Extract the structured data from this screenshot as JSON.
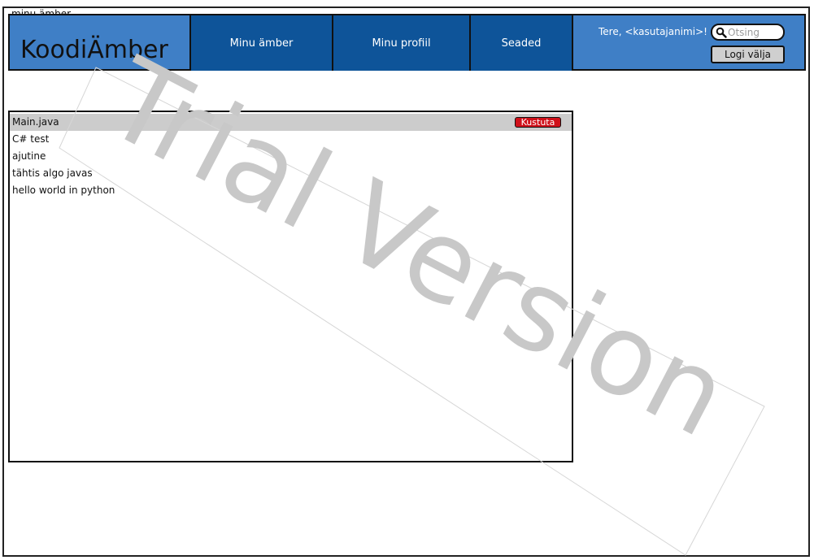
{
  "window": {
    "title": "minu ämber"
  },
  "header": {
    "logo": "KoodiÄmber",
    "nav": [
      {
        "label": "Minu ämber"
      },
      {
        "label": "Minu profiil"
      },
      {
        "label": "Seaded"
      }
    ],
    "greeting": "Tere, <kasutajanimi>!",
    "search": {
      "placeholder": "Otsing",
      "value": ""
    },
    "logout_label": "Logi välja"
  },
  "files": {
    "items": [
      {
        "name": "Main.java",
        "selected": true,
        "delete_label": "Kustuta"
      },
      {
        "name": "C# test"
      },
      {
        "name": "ajutine"
      },
      {
        "name": "tähtis algo javas"
      },
      {
        "name": "hello world in python"
      }
    ]
  },
  "watermark": "Trial Version",
  "colors": {
    "header_bg": "#3f7fc6",
    "nav_bg": "#0e5499",
    "selected_row": "#cccccc",
    "delete_button": "#d0101a",
    "watermark": "#c8c8c8"
  }
}
